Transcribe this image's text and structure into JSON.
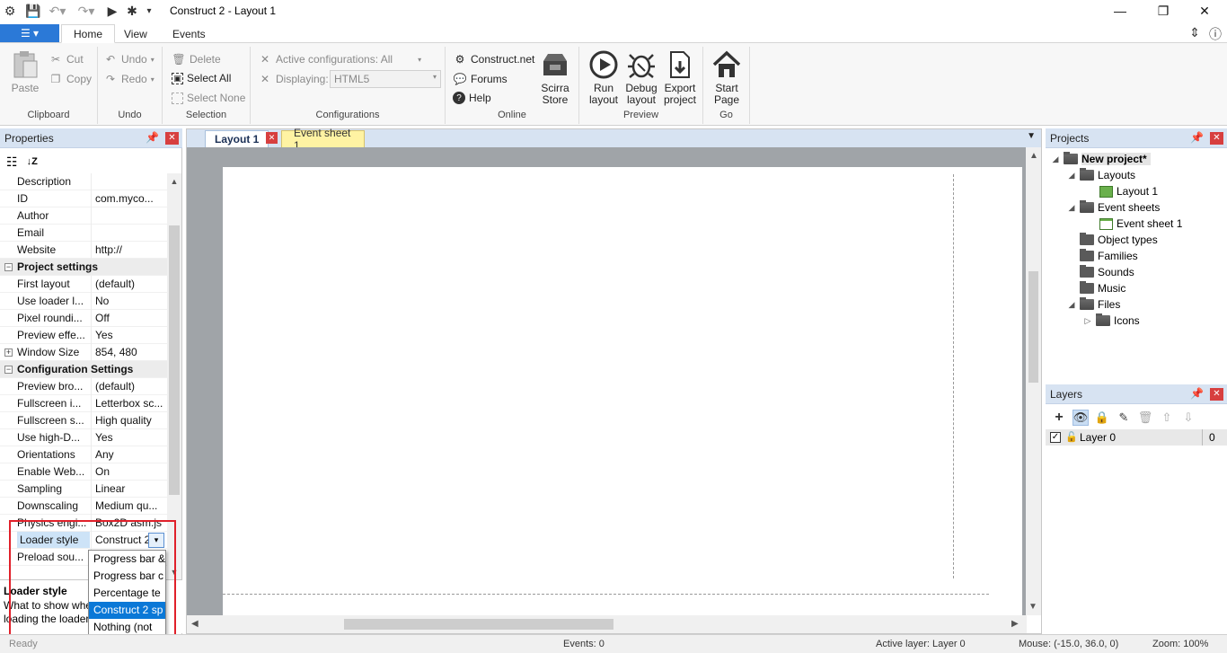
{
  "window": {
    "title": "Construct 2 - Layout 1",
    "minimize": "—",
    "maximize": "❐",
    "close": "✕"
  },
  "ribbon_tabs": [
    "Home",
    "View",
    "Events"
  ],
  "ribbon": {
    "clipboard": {
      "label": "Clipboard",
      "paste": "Paste",
      "cut": "Cut",
      "copy": "Copy"
    },
    "undo": {
      "label": "Undo",
      "undo": "Undo",
      "redo": "Redo"
    },
    "selection": {
      "label": "Selection",
      "delete": "Delete",
      "select_all": "Select All",
      "select_none": "Select None"
    },
    "configurations": {
      "label": "Configurations",
      "active": "Active configurations: All",
      "displaying_label": "Displaying:",
      "displaying_value": "HTML5"
    },
    "online": {
      "label": "Online",
      "construct_net": "Construct.net",
      "forums": "Forums",
      "help": "Help",
      "store_line1": "Scirra",
      "store_line2": "Store"
    },
    "preview": {
      "label": "Preview",
      "run_line1": "Run",
      "run_line2": "layout",
      "debug_line1": "Debug",
      "debug_line2": "layout",
      "export_line1": "Export",
      "export_line2": "project"
    },
    "go": {
      "label": "Go",
      "start_line1": "Start",
      "start_line2": "Page"
    }
  },
  "properties": {
    "title": "Properties",
    "rows": [
      {
        "name": "Description",
        "value": ""
      },
      {
        "name": "ID",
        "value": "com.myco..."
      },
      {
        "name": "Author",
        "value": ""
      },
      {
        "name": "Email",
        "value": ""
      },
      {
        "name": "Website",
        "value": "http://"
      },
      {
        "name": "Project settings",
        "value": ""
      },
      {
        "name": "First layout",
        "value": "(default)"
      },
      {
        "name": "Use loader l...",
        "value": "No"
      },
      {
        "name": "Pixel roundi...",
        "value": "Off"
      },
      {
        "name": "Preview effe...",
        "value": "Yes"
      },
      {
        "name": "Window Size",
        "value": "854, 480"
      },
      {
        "name": "Configuration Settings",
        "value": ""
      },
      {
        "name": "Preview bro...",
        "value": "(default)"
      },
      {
        "name": "Fullscreen i...",
        "value": "Letterbox sc..."
      },
      {
        "name": "Fullscreen s...",
        "value": "High quality"
      },
      {
        "name": "Use high-D...",
        "value": "Yes"
      },
      {
        "name": "Orientations",
        "value": "Any"
      },
      {
        "name": "Enable Web...",
        "value": "On"
      },
      {
        "name": "Sampling",
        "value": "Linear"
      },
      {
        "name": "Downscaling",
        "value": "Medium qu..."
      },
      {
        "name": "Physics engi...",
        "value": "Box2D asm.js"
      },
      {
        "name": "Loader style",
        "value": "Construct 2"
      },
      {
        "name": "Preload sou...",
        "value": ""
      }
    ],
    "expander_collapsed": "+",
    "expander_expanded": "−",
    "description_title": "Loader style",
    "description_text": "What to show when loading the loader"
  },
  "loader_dropdown": {
    "options": [
      "Progress bar &",
      "Progress bar c",
      "Percentage te",
      "Construct 2 sp",
      "Nothing (not"
    ],
    "selected_index": 3
  },
  "editor": {
    "tab_layout": "Layout 1",
    "tab_event": "Event sheet 1"
  },
  "projects": {
    "title": "Projects",
    "root": "New project*",
    "layouts": "Layouts",
    "layout_1": "Layout 1",
    "event_sheets": "Event sheets",
    "event_sheet_1": "Event sheet 1",
    "object_types": "Object types",
    "families": "Families",
    "sounds": "Sounds",
    "music": "Music",
    "files": "Files",
    "icons": "Icons"
  },
  "layers": {
    "title": "Layers",
    "layer_name": "Layer 0",
    "layer_number": "0"
  },
  "status": {
    "ready": "Ready",
    "events": "Events: 0",
    "active_layer": "Active layer: Layer 0",
    "mouse": "Mouse: (-15.0, 36.0, 0)",
    "zoom": "Zoom: 100%"
  }
}
